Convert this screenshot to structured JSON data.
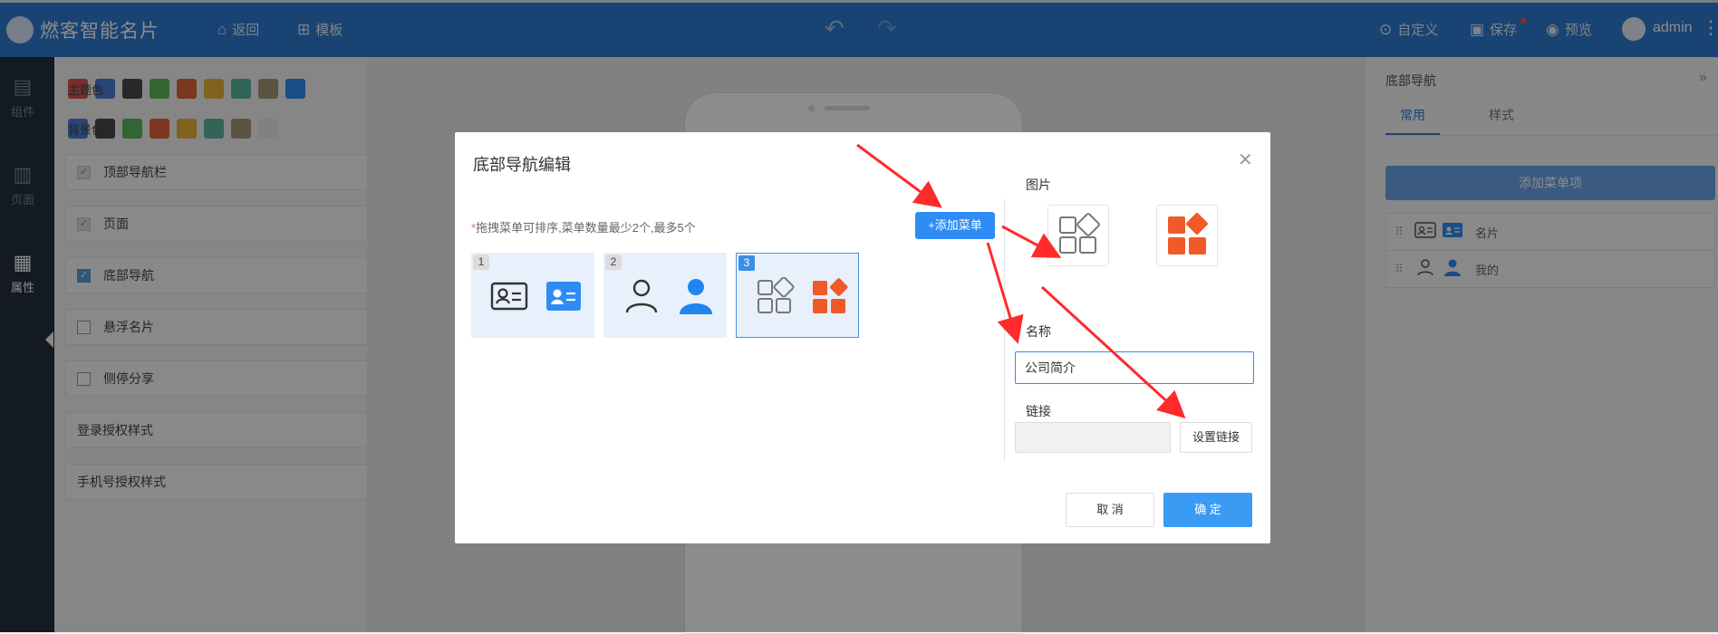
{
  "app": {
    "title": "燃客智能名片"
  },
  "topbar": {
    "back_label": "返回",
    "template_label": "模板",
    "custom_label": "自定义",
    "save_label": "保存",
    "preview_label": "预览",
    "user_name": "admin"
  },
  "rail": {
    "items": [
      {
        "label": "组件",
        "icon": "components-icon"
      },
      {
        "label": "页面",
        "icon": "page-icon"
      },
      {
        "label": "属性",
        "icon": "properties-icon"
      }
    ]
  },
  "props": {
    "theme_color_label": "主题色",
    "bg_color_label": "背景色",
    "theme_colors": [
      "#d9534f",
      "#4a7fd6",
      "#4a4a4a",
      "#5cb85c",
      "#e0643a",
      "#e8b43a",
      "#5bb6a0",
      "#a89a7a",
      "#2f8cf5"
    ],
    "bg_colors": [
      "#4a7fd6",
      "#4a4a4a",
      "#5cb85c",
      "#e0643a",
      "#e8b43a",
      "#5bb6a0",
      "#a89a7a",
      "#e9e9e9"
    ],
    "settings": [
      {
        "label": "顶部导航栏"
      },
      {
        "label": "页面"
      },
      {
        "label": "底部导航"
      },
      {
        "label": "悬浮名片"
      },
      {
        "label": "侧停分享"
      },
      {
        "label": "登录授权样式"
      },
      {
        "label": "手机号授权样式"
      }
    ]
  },
  "right_panel": {
    "title": "底部导航",
    "tab_common": "常用",
    "tab_style": "样式",
    "add_item_label": "添加菜单项",
    "items": [
      {
        "label": "名片"
      },
      {
        "label": "我的"
      }
    ]
  },
  "modal": {
    "title": "底部导航编辑",
    "hint_required": "*",
    "hint": "拖拽菜单可排序,菜单数量最少2个,最多5个",
    "add_menu_label": "添加菜单",
    "add_menu_plus": "+",
    "menu_numbers": [
      "1",
      "2",
      "3"
    ],
    "image_label": "图片",
    "name_label": "名称",
    "name_value": "公司简介",
    "link_label": "链接",
    "link_value": "",
    "set_link_label": "设置链接",
    "cancel_label": "取 消",
    "confirm_label": "确 定",
    "accent_color": "#2f8cf5",
    "orange_color": "#f05a28"
  }
}
